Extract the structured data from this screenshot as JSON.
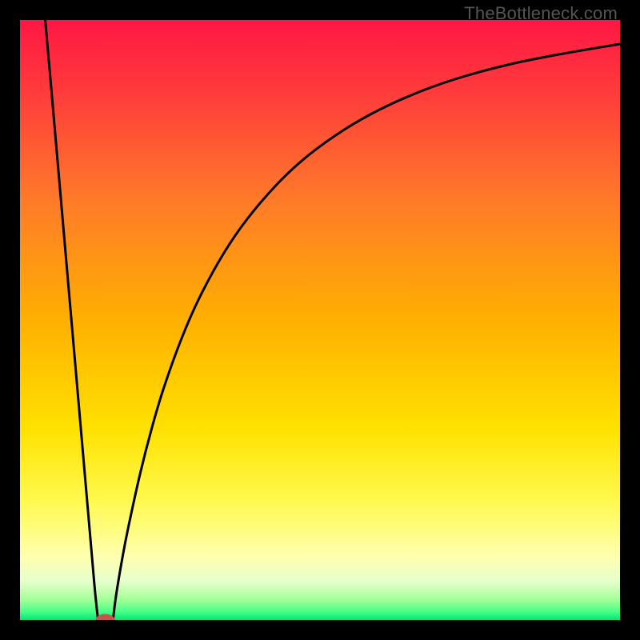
{
  "watermark": "TheBottleneck.com",
  "chart_data": {
    "type": "line",
    "title": "",
    "xlabel": "",
    "ylabel": "",
    "xlim": [
      0,
      100
    ],
    "ylim": [
      0,
      100
    ],
    "gradient_stops": [
      {
        "offset": 0.0,
        "color": "#ff1744"
      },
      {
        "offset": 0.12,
        "color": "#ff3b3b"
      },
      {
        "offset": 0.3,
        "color": "#ff7a29"
      },
      {
        "offset": 0.5,
        "color": "#ffb000"
      },
      {
        "offset": 0.68,
        "color": "#ffe100"
      },
      {
        "offset": 0.8,
        "color": "#fff94d"
      },
      {
        "offset": 0.895,
        "color": "#ffffb0"
      },
      {
        "offset": 0.935,
        "color": "#e6ffcc"
      },
      {
        "offset": 0.965,
        "color": "#a6ff99"
      },
      {
        "offset": 0.985,
        "color": "#4dff88"
      },
      {
        "offset": 1.0,
        "color": "#00e676"
      }
    ],
    "series": [
      {
        "name": "left-curve",
        "x": [
          4.2,
          5.0,
          6.0,
          7.0,
          8.0,
          9.0,
          10.0,
          11.0,
          12.0,
          12.5,
          13.0
        ],
        "values": [
          100,
          91,
          79.5,
          68,
          56.5,
          45,
          33.5,
          22,
          10.5,
          4.8,
          0.0
        ]
      },
      {
        "name": "right-curve",
        "x": [
          15.5,
          16,
          17,
          18,
          20,
          22,
          24,
          27,
          30,
          34,
          38,
          43,
          48,
          54,
          60,
          67,
          74,
          82,
          90,
          100
        ],
        "values": [
          0.0,
          4,
          10,
          15.2,
          24.3,
          32.1,
          38.8,
          47.1,
          53.9,
          61.2,
          67,
          72.8,
          77.4,
          81.7,
          85.1,
          88.2,
          90.6,
          92.7,
          94.3,
          96.0
        ]
      }
    ],
    "marker": {
      "name": "bottleneck-point",
      "x": 14.2,
      "y": 0.0,
      "rx": 1.6,
      "ry": 1.0,
      "color": "#c0574a"
    }
  }
}
